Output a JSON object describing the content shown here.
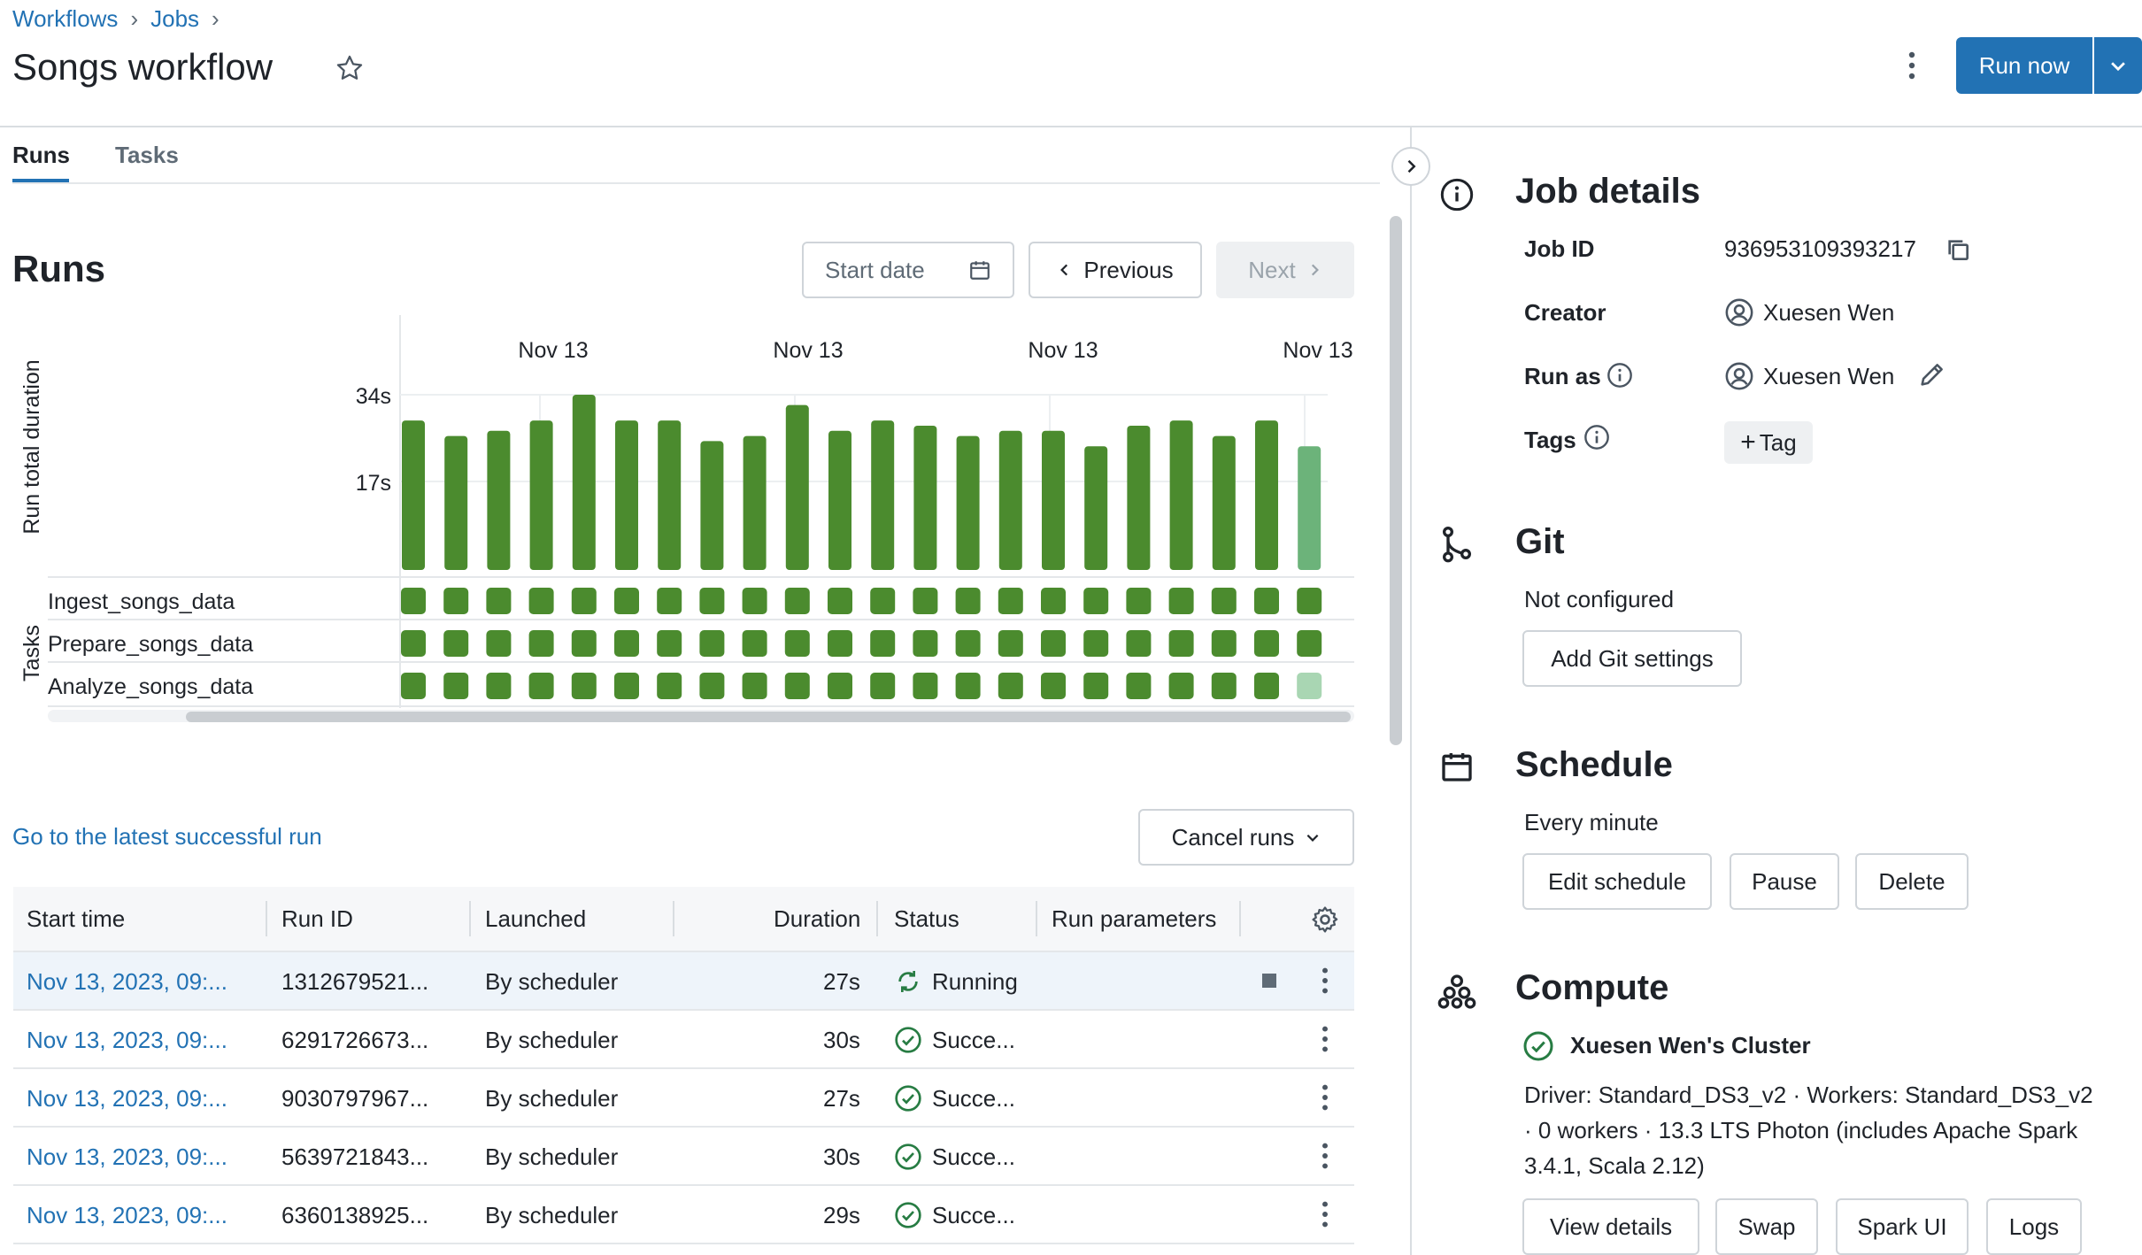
{
  "breadcrumb": {
    "items": [
      "Workflows",
      "Jobs"
    ]
  },
  "page": {
    "title": "Songs workflow"
  },
  "header": {
    "run_now": "Run now"
  },
  "tabs": [
    {
      "label": "Runs",
      "active": true
    },
    {
      "label": "Tasks",
      "active": false
    }
  ],
  "runs": {
    "title": "Runs",
    "start_date_placeholder": "Start date",
    "previous": "Previous",
    "next": "Next",
    "latest_link": "Go to the latest successful run",
    "cancel_runs": "Cancel runs"
  },
  "chart_data": {
    "type": "bar",
    "ylabel": "Run total duration",
    "yticks": [
      "34s",
      "17s"
    ],
    "xticks": [
      "Nov 13",
      "Nov 13",
      "Nov 13",
      "Nov 13"
    ],
    "values": [
      29,
      26,
      27,
      29,
      34,
      29,
      29,
      25,
      26,
      32,
      27,
      29,
      28,
      26,
      27,
      27,
      24,
      28,
      29,
      26,
      29,
      24
    ],
    "last_running": true,
    "ylim": [
      0,
      34
    ],
    "bar_color": "#4b8b2e",
    "running_color": "#6cb37a",
    "tasks_label": "Tasks",
    "tasks": [
      "Ingest_songs_data",
      "Prepare_songs_data",
      "Analyze_songs_data"
    ]
  },
  "table": {
    "columns": [
      "Start time",
      "Run ID",
      "Launched",
      "Duration",
      "Status",
      "Run parameters"
    ],
    "rows": [
      {
        "start": "Nov 13, 2023, 09:...",
        "run_id": "1312679521...",
        "launched": "By scheduler",
        "duration": "27s",
        "status": "Running"
      },
      {
        "start": "Nov 13, 2023, 09:...",
        "run_id": "6291726673...",
        "launched": "By scheduler",
        "duration": "30s",
        "status": "Succe..."
      },
      {
        "start": "Nov 13, 2023, 09:...",
        "run_id": "9030797967...",
        "launched": "By scheduler",
        "duration": "27s",
        "status": "Succe..."
      },
      {
        "start": "Nov 13, 2023, 09:...",
        "run_id": "5639721843...",
        "launched": "By scheduler",
        "duration": "30s",
        "status": "Succe..."
      },
      {
        "start": "Nov 13, 2023, 09:...",
        "run_id": "6360138925...",
        "launched": "By scheduler",
        "duration": "29s",
        "status": "Succe..."
      }
    ]
  },
  "details": {
    "title": "Job details",
    "job_id_label": "Job ID",
    "job_id": "936953109393217",
    "creator_label": "Creator",
    "creator": "Xuesen Wen",
    "run_as_label": "Run as",
    "run_as": "Xuesen Wen",
    "tags_label": "Tags",
    "add_tag": "Tag"
  },
  "git": {
    "title": "Git",
    "status": "Not configured",
    "add": "Add Git settings"
  },
  "schedule": {
    "title": "Schedule",
    "value": "Every minute",
    "edit": "Edit schedule",
    "pause": "Pause",
    "delete": "Delete"
  },
  "compute": {
    "title": "Compute",
    "cluster": "Xuesen Wen's Cluster",
    "line1": "Driver: Standard_DS3_v2 · Workers: Standard_DS3_v2",
    "line2": "· 0 workers · 13.3 LTS Photon (includes Apache Spark",
    "line3": "3.4.1, Scala 2.12)",
    "view": "View details",
    "swap": "Swap",
    "spark": "Spark UI",
    "logs": "Logs"
  },
  "colors": {
    "accent": "#2272b4",
    "success": "#277c43",
    "bar": "#4b8b2e"
  }
}
